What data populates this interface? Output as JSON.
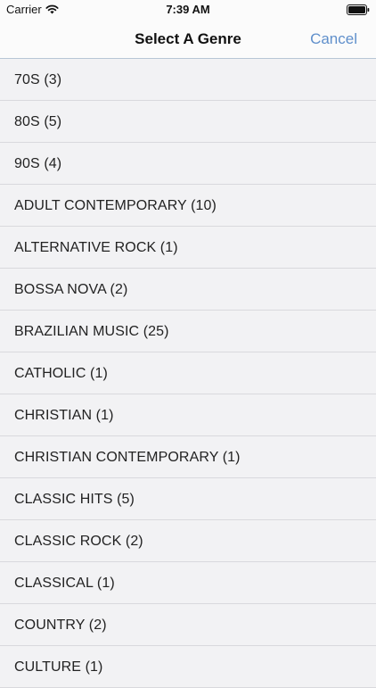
{
  "status": {
    "carrier": "Carrier",
    "time": "7:39 AM",
    "icons": [
      "wifi-icon",
      "battery-icon"
    ]
  },
  "nav": {
    "title": "Select A Genre",
    "cancel_label": "Cancel",
    "accent_color": "#5f8fcb"
  },
  "genres": [
    "70S (3)",
    "80S (5)",
    "90S (4)",
    "ADULT CONTEMPORARY (10)",
    "ALTERNATIVE ROCK (1)",
    "BOSSA NOVA (2)",
    "BRAZILIAN MUSIC (25)",
    "CATHOLIC (1)",
    "CHRISTIAN (1)",
    "CHRISTIAN CONTEMPORARY (1)",
    "CLASSIC HITS (5)",
    "CLASSIC ROCK (2)",
    "CLASSICAL (1)",
    "COUNTRY (2)",
    "CULTURE (1)"
  ]
}
